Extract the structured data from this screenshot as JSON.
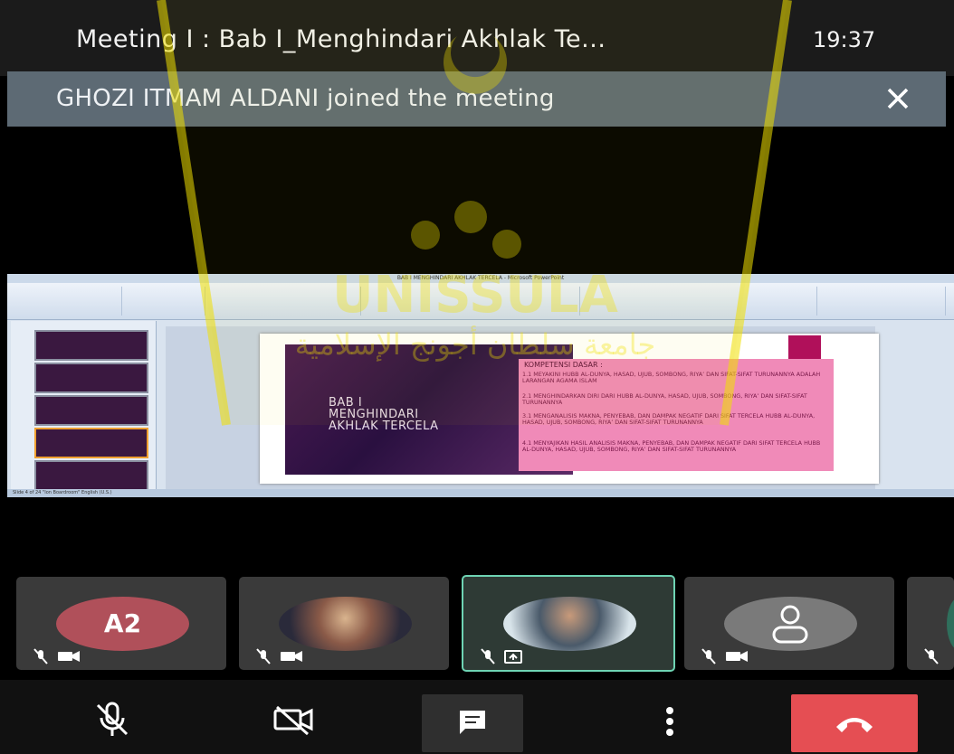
{
  "header": {
    "meeting_title": "Meeting I : Bab I_Menghindari Akhlak Te...",
    "clock": "19:37"
  },
  "notification": {
    "text": "GHOZI ITMAM ALDANI joined the meeting",
    "close_icon": "close-icon"
  },
  "shared_screen": {
    "window_title": "BAB I MENGHINDARI AKHLAK TERCELA - Microsoft PowerPoint",
    "status_text": "Slide 4 of 24   \"Ion Boardroom\"   English (U.S.)",
    "slide": {
      "title": "BAB I\nMENGHINDARI\nAKHLAK TERCELA",
      "heading": "KOMPETENSI DASAR :",
      "items": [
        "1.1 MEYAKINI HUBB AL-DUNYA, HASAD, UJUB, SOMBONG, RIYA’ DAN SIFAT-SIFAT TURUNANNYA ADALAH LARANGAN AGAMA ISLAM",
        "2.1 MENGHINDARKAN DIRI DARI HUBB AL-DUNYA, HASAD, UJUB, SOMBONG, RIYA’ DAN SIFAT-SIFAT TURUNANNYA",
        "3.1 MENGANALISIS MAKNA, PENYEBAB, DAN DAMPAK NEGATIF DARI SIFAT TERCELA HUBB AL-DUNYA, HASAD, UJUB, SOMBONG, RIYA’ DAN SIFAT-SIFAT TURUNANNYA",
        "4.1 MENYAJIKAN HASIL ANALISIS MAKNA, PENYEBAB, DAN DAMPAK NEGATIF DARI SIFAT TERCELA HUBB AL-DUNYA, HASAD, UJUB, SOMBONG, RIYA’ DAN SIFAT-SIFAT TURUNANNYA"
      ]
    }
  },
  "watermark": {
    "text": "UNISSULA",
    "arabic": "جامعة سلطان أجونج الإسلامية"
  },
  "participants": [
    {
      "initials": "A2",
      "avatar_color": "#b0505a",
      "mic": "mic-off-icon",
      "cam": "camera-off-icon"
    },
    {
      "photo": "person-photo",
      "mic": "mic-off-icon",
      "cam": "camera-off-icon"
    },
    {
      "photo": "person-photo",
      "mic": "mic-off-icon",
      "cam": "screen-share-icon",
      "active": true
    },
    {
      "photo": "default-avatar-icon",
      "mic": "mic-off-icon",
      "cam": "camera-off-icon"
    }
  ],
  "controls": {
    "mic": "mic-off-icon",
    "camera": "camera-off-icon",
    "chat": "chat-icon",
    "more": "more-vertical-icon",
    "end": "end-call-icon",
    "end_color": "#e54e53"
  }
}
